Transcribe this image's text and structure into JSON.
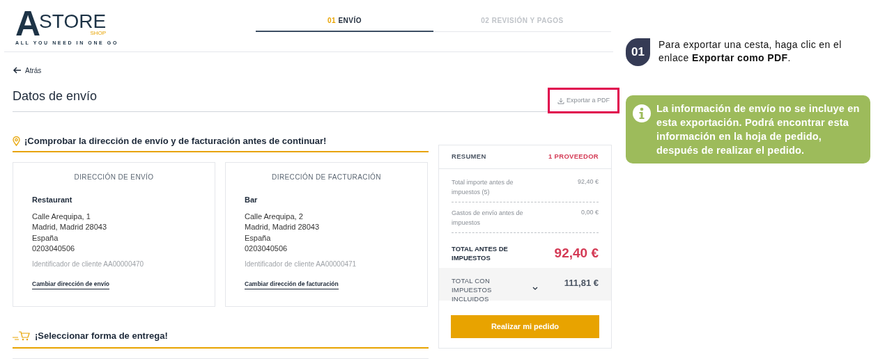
{
  "logo": {
    "mark": "A",
    "name": "STORE",
    "sub": "SHOP",
    "tagline": "ALL YOU NEED IN ONE GO"
  },
  "steps": [
    {
      "number": "01",
      "label": "ENVÍO",
      "selected": true
    },
    {
      "number": "02",
      "label": "REVISIÓN Y PAGOS",
      "selected": false
    }
  ],
  "back_link": "Atrás",
  "page_title": "Datos de envío",
  "export_link": {
    "label": "Exportar a PDF",
    "highlighted": true
  },
  "address_section": {
    "title": "¡Comprobar la dirección de envío y de facturación antes de continuar!",
    "cards": [
      {
        "heading": "DIRECCIÓN DE ENVÍO",
        "name": "Restaurant",
        "lines": [
          "Calle Arequipa, 1",
          "Madrid, Madrid 28043",
          "España",
          "0203040506"
        ],
        "customer_id": "Identificador de cliente AA00000470",
        "change_link": "Cambiar dirección de envío"
      },
      {
        "heading": "DIRECCIÓN DE FACTURACIÓN",
        "name": "Bar",
        "lines": [
          "Calle Arequipa, 2",
          "Madrid, Madrid 28043",
          "España",
          "0203040506"
        ],
        "customer_id": "Identificador de cliente AA00000471",
        "change_link": "Cambiar dirección de facturación"
      }
    ]
  },
  "delivery_section": {
    "title": "¡Seleccionar forma de entrega!"
  },
  "summary": {
    "title": "RESUMEN",
    "suppliers": "1 PROVEEDOR",
    "rows": [
      {
        "label": "Total importe antes de impuestos (5)",
        "value": "92,40 €"
      },
      {
        "label": "Gastos de envío antes de impuestos",
        "value": "0,00 €"
      }
    ],
    "total_label": "TOTAL ANTES DE IMPUESTOS",
    "total_value": "92,40 €",
    "tax_label": "TOTAL CON IMPUESTOS INCLUIDOS",
    "tax_value": "111,81 €",
    "order_button": "Realizar mi pedido"
  },
  "callout": {
    "step": "01",
    "text": "Para exportar una cesta, haga clic en el enlace **Exportar como PDF**."
  },
  "note": {
    "text": "La información de envío no se incluye en esta exportación. Podrá encontrar esta información en la hoja de pedido, después de  realizar el pedido."
  }
}
